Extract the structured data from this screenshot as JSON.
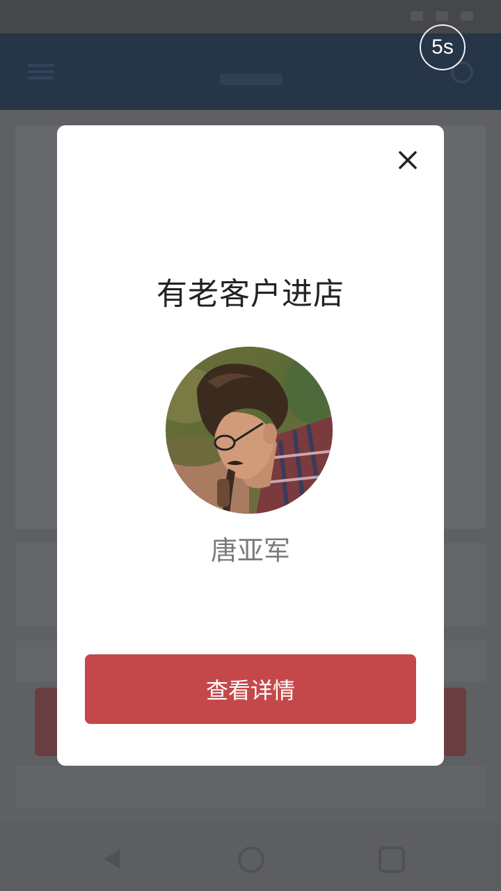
{
  "countdown": {
    "label": "5s"
  },
  "modal": {
    "title": "有老客户进店",
    "customer_name": "唐亚军",
    "detail_button_label": "查看详情",
    "close_icon": "close-icon",
    "avatar_icon": "customer-avatar-photo"
  },
  "colors": {
    "header_bg": "#263548",
    "button_bg": "#c4484a",
    "overlay": "#5f6063"
  }
}
